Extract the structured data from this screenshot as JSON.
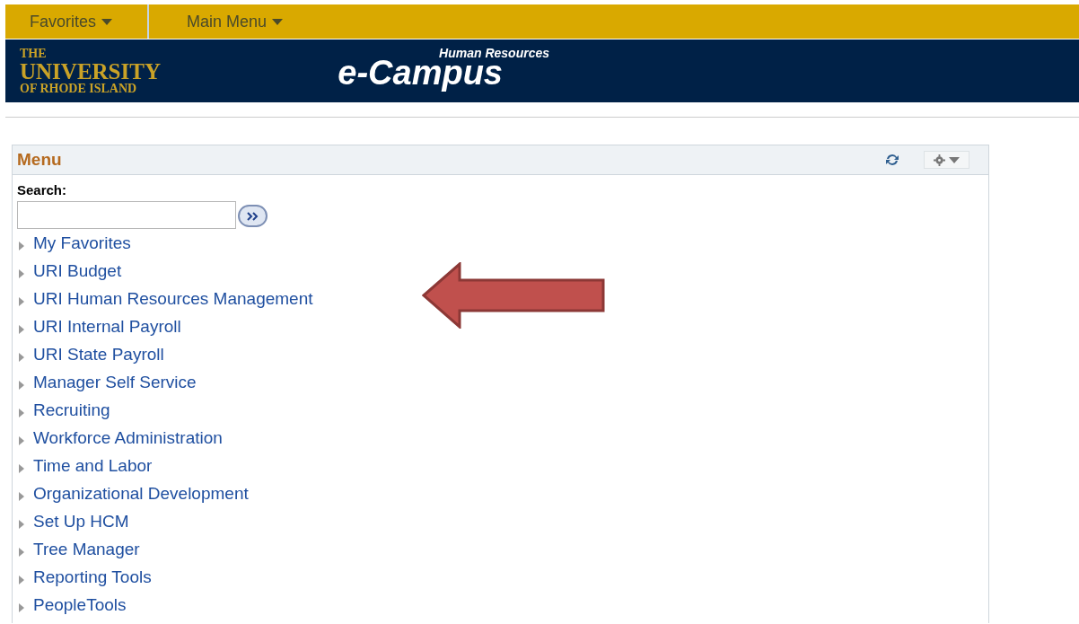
{
  "nav_bar": {
    "menus": [
      {
        "label": "Favorites"
      },
      {
        "label": "Main Menu"
      }
    ]
  },
  "banner": {
    "logo_lines": [
      "THE",
      "UNIVERSITY",
      "OF RHODE ISLAND"
    ],
    "subtitle": "Human Resources",
    "title": "e-Campus"
  },
  "menu_panel": {
    "title": "Menu",
    "search_label": "Search:",
    "items": [
      {
        "label": "My Favorites",
        "expanded": false
      },
      {
        "label": "URI Budget",
        "expanded": false
      },
      {
        "label": "URI Human Resources Management",
        "expanded": false
      },
      {
        "label": "URI Internal Payroll",
        "expanded": false
      },
      {
        "label": "URI State Payroll",
        "expanded": false
      },
      {
        "label": "Manager Self Service",
        "expanded": false
      },
      {
        "label": "Recruiting",
        "expanded": false
      },
      {
        "label": "Workforce Administration",
        "expanded": false
      },
      {
        "label": "Time and Labor",
        "expanded": false
      },
      {
        "label": "Organizational Development",
        "expanded": false
      },
      {
        "label": "Set Up HCM",
        "expanded": false
      },
      {
        "label": "Tree Manager",
        "expanded": false
      },
      {
        "label": "Reporting Tools",
        "expanded": false
      },
      {
        "label": "PeopleTools",
        "expanded": false
      }
    ]
  }
}
